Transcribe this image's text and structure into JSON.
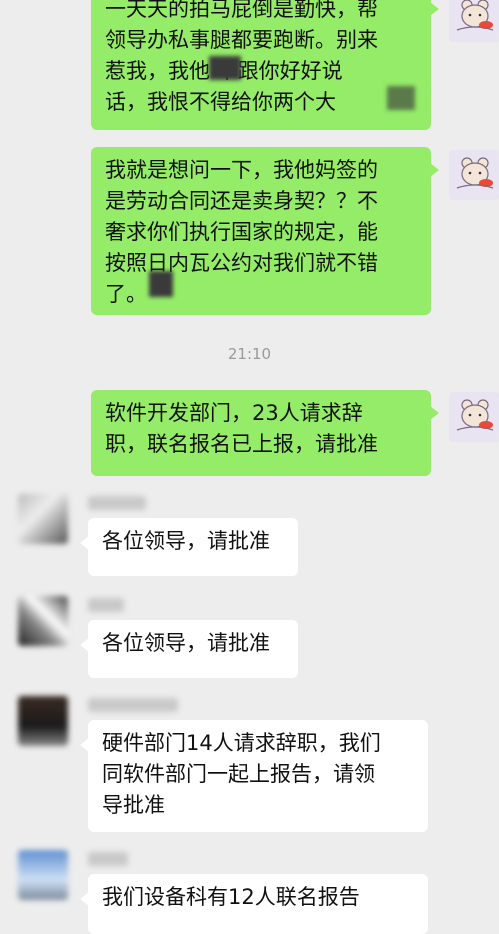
{
  "messages": [
    {
      "side": "me",
      "lines": [
        "一天天的拍马屁倒是勤快，帮",
        "领导办私事腿都要跑断。别来",
        "惹我，我他 不跟你好好说",
        "话，我恨不得给你两个大 "
      ]
    },
    {
      "side": "me",
      "lines": [
        "我就是想问一下，我他妈签的",
        "是劳动合同还是卖身契？？不",
        "奢求你们执行国家的规定，能",
        "按照日内瓦公约对我们就不错",
        "了。"
      ]
    },
    {
      "timestamp": "21:10"
    },
    {
      "side": "me",
      "lines": [
        "软件开发部门，23人请求辞",
        "职，联名报名已上报，请批准"
      ]
    },
    {
      "side": "other",
      "lines": [
        "各位领导，请批准"
      ]
    },
    {
      "side": "other",
      "lines": [
        "各位领导，请批准"
      ]
    },
    {
      "side": "other",
      "lines": [
        "硬件部门14人请求辞职，我们",
        "同软件部门一起上报告，请领",
        "导批准"
      ]
    },
    {
      "side": "other",
      "lines": [
        "我们设备科有12人联名报告"
      ]
    }
  ],
  "colors": {
    "background": "#ededed",
    "my_bubble": "#95ec69",
    "other_bubble": "#ffffff",
    "timestamp": "#9a9a9a"
  },
  "icons": {
    "my_avatar": "cartoon-bear-avatar-icon"
  }
}
